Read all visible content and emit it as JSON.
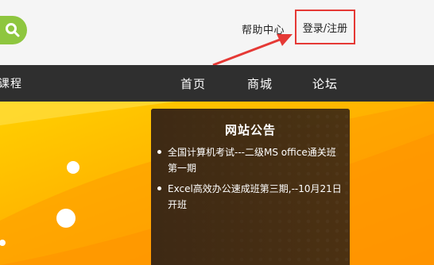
{
  "header": {
    "help_label": "帮助中心",
    "login_label": "登录/注册"
  },
  "nav": {
    "left_item": "课程",
    "items": [
      {
        "label": "首页"
      },
      {
        "label": "商城"
      },
      {
        "label": "论坛"
      }
    ]
  },
  "notice": {
    "title": "网站公告",
    "items": [
      {
        "text": "全国计算机考试---二级MS office通关班 第一期"
      },
      {
        "text": "Excel高效办公速成班第三期,--10月21日开班"
      }
    ]
  },
  "colors": {
    "search_button": "#8ec63f",
    "highlight_border": "#e53935",
    "nav_background": "#2f2f2f",
    "banner_orange": "#ff9800"
  }
}
